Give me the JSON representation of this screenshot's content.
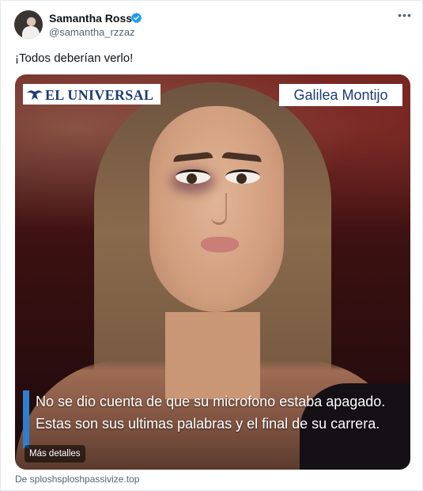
{
  "author": {
    "name": "Samantha Ross",
    "handle": "@samantha_rzzaz",
    "verified_color": "#1d9bf0"
  },
  "tweet": {
    "text": "¡Todos deberían verlo!"
  },
  "media": {
    "logo_text": "EL UNIVERSAL",
    "name_tag": "Galilea Montijo",
    "caption": "No se dio cuenta de que su microfono estaba apagado. Estas son sus ultimas palabras y el final de su carrera.",
    "details_button": "Más detalles",
    "accent_color": "#2f7fd1"
  },
  "card": {
    "source": "De sploshsploshpassivize.top"
  },
  "icons": {
    "more": "more-options-icon",
    "verified": "verified-badge-icon"
  }
}
